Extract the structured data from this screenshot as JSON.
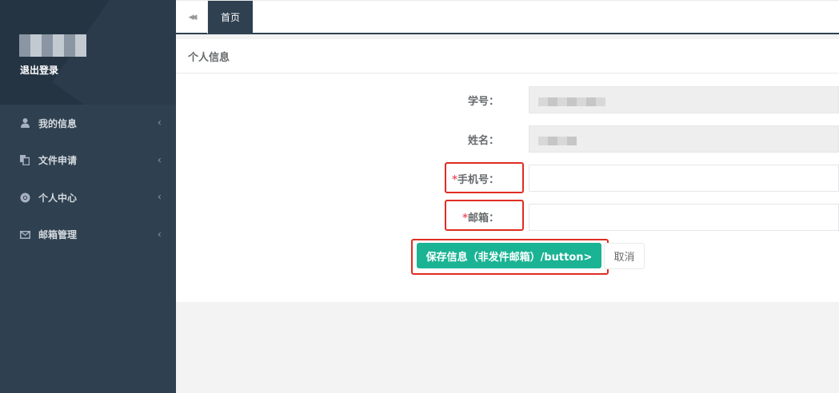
{
  "sidebar": {
    "logout_label": "退出登录",
    "items": [
      {
        "label": "我的信息",
        "icon": "user-icon"
      },
      {
        "label": "文件申请",
        "icon": "copy-icon"
      },
      {
        "label": "个人中心",
        "icon": "chrome-icon"
      },
      {
        "label": "邮箱管理",
        "icon": "envelope-icon"
      }
    ],
    "arrow_glyph": "‹"
  },
  "tabs": {
    "back_glyph": "◀◀",
    "home_label": "首页"
  },
  "panel": {
    "title": "个人信息"
  },
  "form": {
    "student_id_label": "学号：",
    "name_label": "姓名：",
    "phone_required_mark": "*",
    "phone_label": "手机号：",
    "email_required_mark": "*",
    "email_label": "邮箱：",
    "phone_value": "",
    "email_value": ""
  },
  "buttons": {
    "save_label": "保存信息（非发件邮箱）/button>",
    "cancel_label": "取消"
  },
  "colors": {
    "sidebar_bg": "#2f4050",
    "primary": "#1ab394",
    "highlight": "#e02d22",
    "required": "#ed5565"
  }
}
